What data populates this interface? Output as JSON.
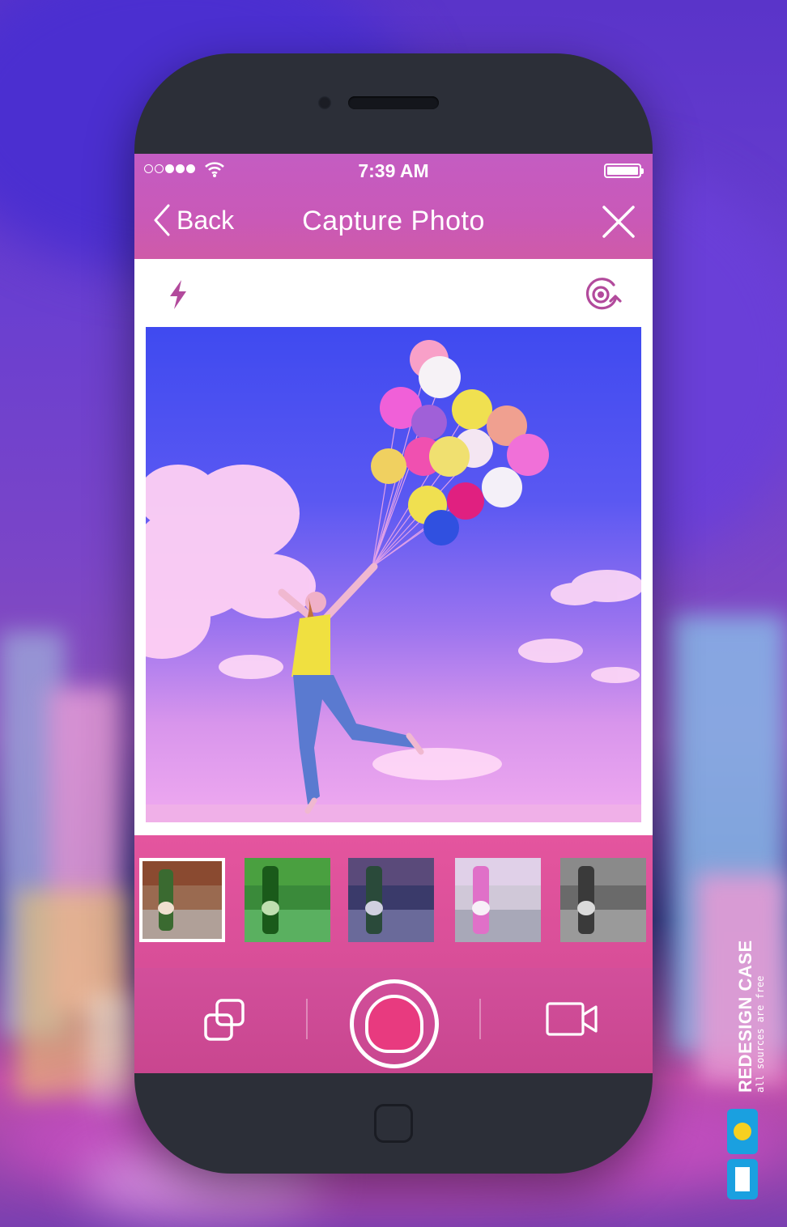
{
  "status_bar": {
    "time": "7:39 AM",
    "signal_bars_filled": 3,
    "signal_bars_total": 5
  },
  "nav": {
    "back_label": "Back",
    "title": "Capture Photo"
  },
  "icons": {
    "back": "chevron-left-icon",
    "close": "close-icon",
    "flash": "flash-icon",
    "flip_camera": "flip-camera-icon",
    "gallery": "gallery-icon",
    "shutter": "shutter-icon",
    "video": "video-camera-icon"
  },
  "filters": [
    {
      "name": "filter-warm",
      "selected": true
    },
    {
      "name": "filter-green",
      "selected": false
    },
    {
      "name": "filter-cool",
      "selected": false
    },
    {
      "name": "filter-pink",
      "selected": false
    },
    {
      "name": "filter-mono",
      "selected": false
    }
  ],
  "watermark": {
    "brand": "REDESIGN CASE",
    "tagline": "all sources are free"
  },
  "colors": {
    "accent": "#c9559f",
    "header": "#c65bbb",
    "shutter": "#e83a7f",
    "icon": "#b24a9c"
  }
}
